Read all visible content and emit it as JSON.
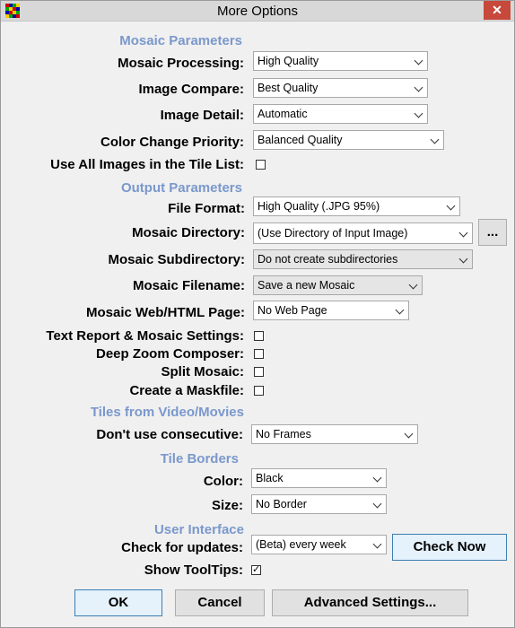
{
  "window": {
    "title": "More Options",
    "close_label": "✕"
  },
  "sections": {
    "mosaic": "Mosaic Parameters",
    "output": "Output Parameters",
    "video": "Tiles from Video/Movies",
    "borders": "Tile Borders",
    "ui": "User Interface"
  },
  "mosaic": {
    "processing_label": "Mosaic Processing:",
    "processing_value": "High Quality",
    "compare_label": "Image Compare:",
    "compare_value": "Best Quality",
    "detail_label": "Image Detail:",
    "detail_value": "Automatic",
    "priority_label": "Color Change Priority:",
    "priority_value": "Balanced Quality",
    "use_all_label": "Use All Images in the Tile List:",
    "use_all_checked": ""
  },
  "output": {
    "format_label": "File Format:",
    "format_value": "High Quality (.JPG 95%)",
    "directory_label": "Mosaic Directory:",
    "directory_value": "(Use Directory of Input Image)",
    "browse_label": "...",
    "subdir_label": "Mosaic Subdirectory:",
    "subdir_value": "Do not create subdirectories",
    "filename_label": "Mosaic Filename:",
    "filename_value": "Save a new Mosaic",
    "web_label": "Mosaic Web/HTML Page:",
    "web_value": "No Web Page",
    "text_report_label": "Text Report & Mosaic Settings:",
    "deep_zoom_label": "Deep Zoom Composer:",
    "split_label": "Split Mosaic:",
    "maskfile_label": "Create a Maskfile:"
  },
  "video": {
    "consecutive_label": "Don't use consecutive:",
    "consecutive_value": "No Frames"
  },
  "borders": {
    "color_label": "Color:",
    "color_value": "Black",
    "size_label": "Size:",
    "size_value": "No Border"
  },
  "ui": {
    "updates_label": "Check for updates:",
    "updates_value": "(Beta) every week",
    "check_now_label": "Check Now",
    "tooltips_label": "Show ToolTips:",
    "tooltips_checked": "✓"
  },
  "footer": {
    "ok_label": "OK",
    "cancel_label": "Cancel",
    "advanced_label": "Advanced Settings..."
  },
  "colors": {
    "section_heading": "#7a98cc",
    "close_button": "#c7493b",
    "primary_border": "#3c7fb1"
  }
}
